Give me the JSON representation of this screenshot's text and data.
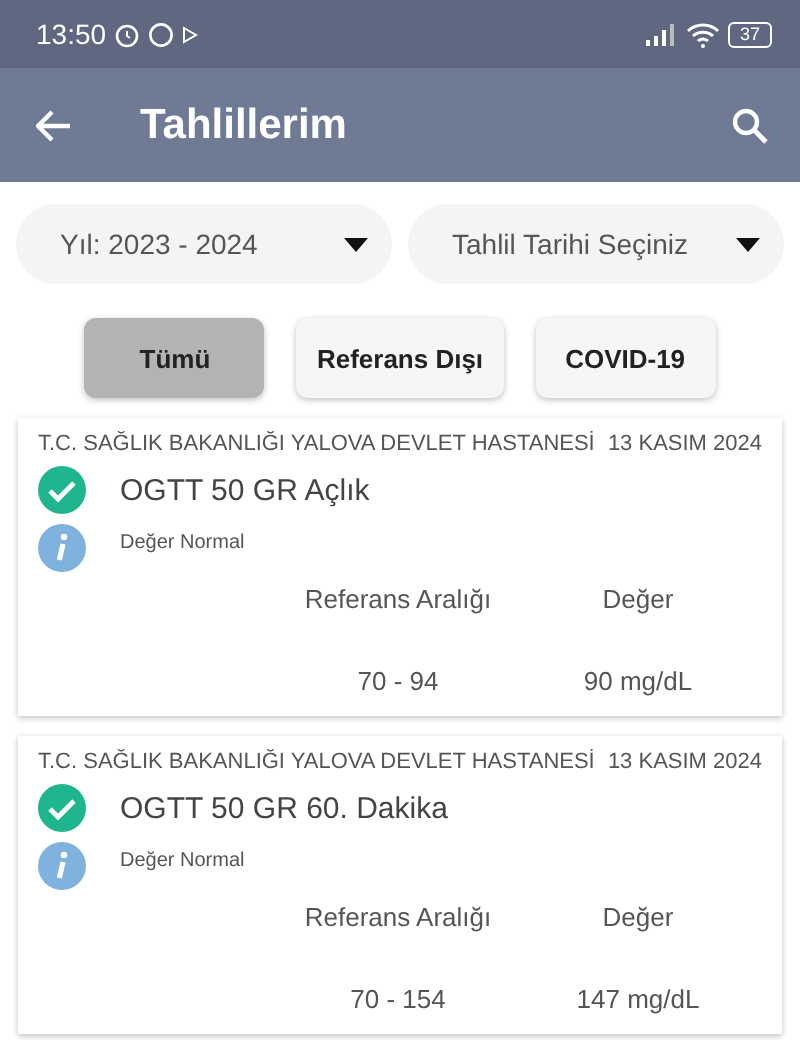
{
  "status_bar": {
    "time": "13:50",
    "battery": "37"
  },
  "app_bar": {
    "title": "Tahlillerim"
  },
  "filters": [
    {
      "value": "Yıl: 2023 - 2024"
    },
    {
      "value": "Tahlil Tarihi Seçiniz"
    }
  ],
  "chips": [
    {
      "label": "Tümü",
      "selected": true
    },
    {
      "label": "Referans Dışı",
      "selected": false
    },
    {
      "label": "COVID-19",
      "selected": false
    }
  ],
  "results": [
    {
      "hospital": "T.C. SAĞLIK BAKANLIĞI YALOVA DEVLET HASTANESİ",
      "date": "13 KASIM 2024",
      "test": "OGTT 50 GR Açlık",
      "kind": "normal",
      "note": "Değer Normal",
      "range_label": "Referans Aralığı",
      "value_label": "Değer",
      "range": "70 - 94",
      "value": "90 mg/dL"
    },
    {
      "hospital": "T.C. SAĞLIK BAKANLIĞI YALOVA DEVLET HASTANESİ",
      "date": "13 KASIM 2024",
      "test": "OGTT 50 GR 60. Dakika",
      "kind": "normal",
      "note": "Değer Normal",
      "range_label": "Referans Aralığı",
      "value_label": "Değer",
      "range": "70 - 154",
      "value": "147 mg/dL"
    }
  ]
}
